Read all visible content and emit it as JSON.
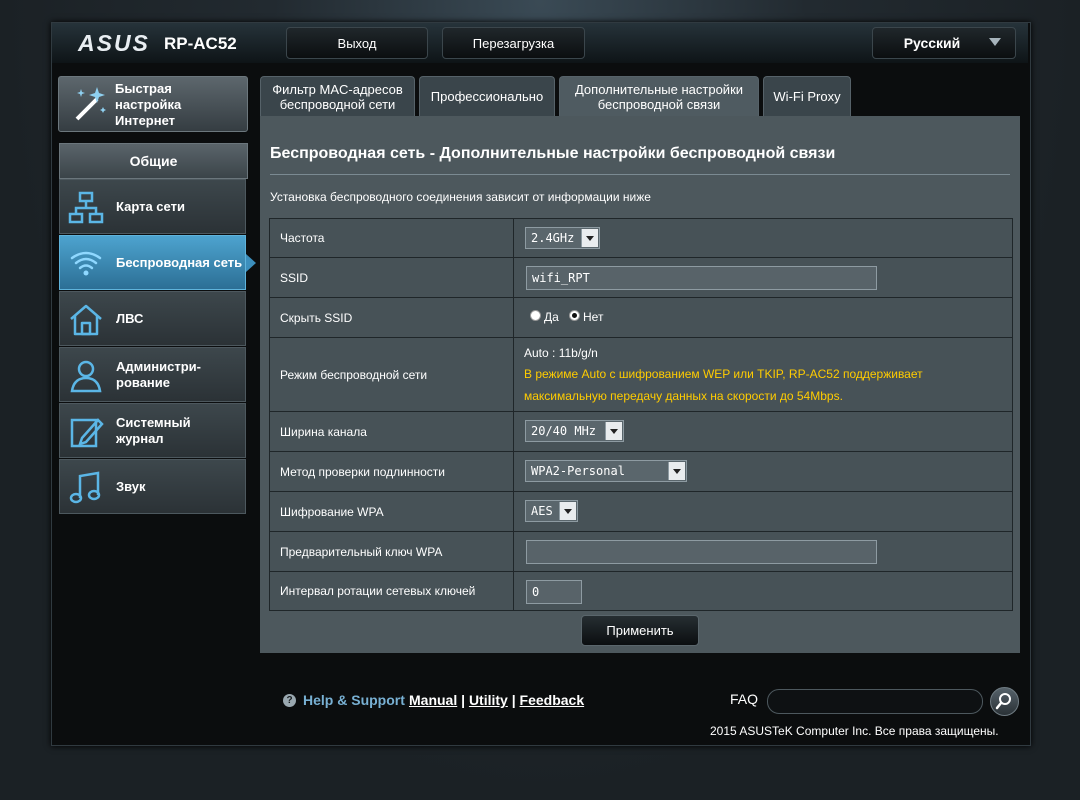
{
  "header": {
    "brand": "ASUS",
    "model": "RP-AC52",
    "logout": "Выход",
    "reboot": "Перезагрузка",
    "language": "Русский"
  },
  "sidebar": {
    "quick_setup": [
      "Быстрая",
      "настройка",
      "Интернет"
    ],
    "section": "Общие",
    "items": [
      {
        "icon": "network-map-icon",
        "lines": [
          "Карта сети"
        ]
      },
      {
        "icon": "wifi-icon",
        "lines": [
          "Беспроводная сеть"
        ]
      },
      {
        "icon": "home-icon",
        "lines": [
          "ЛВС"
        ]
      },
      {
        "icon": "user-admin-icon",
        "lines": [
          "Администри-",
          "рование"
        ]
      },
      {
        "icon": "edit-log-icon",
        "lines": [
          "Системный",
          "журнал"
        ]
      },
      {
        "icon": "music-note-icon",
        "lines": [
          "Звук"
        ]
      }
    ]
  },
  "tabs": [
    {
      "lines": [
        "Фильтр MAC-адресов",
        "беспроводной сети"
      ]
    },
    {
      "lines": [
        "Профессионально"
      ]
    },
    {
      "lines": [
        "Дополнительные настройки",
        "беспроводной связи"
      ]
    },
    {
      "lines": [
        "Wi-Fi Proxy"
      ]
    }
  ],
  "page": {
    "title": "Беспроводная сеть - Дополнительные настройки беспроводной связи",
    "description": "Установка беспроводного соединения зависит от информации ниже"
  },
  "form": {
    "frequency": {
      "label": "Частота",
      "value": "2.4GHz"
    },
    "ssid": {
      "label": "SSID",
      "value": "wifi_RPT"
    },
    "hide_ssid": {
      "label": "Скрыть SSID",
      "yes": "Да",
      "no": "Нет",
      "selected": "no"
    },
    "wireless_mode": {
      "label": "Режим беспроводной сети",
      "value": "Auto : 11b/g/n",
      "warning1": "В режиме Auto с шифрованием WEP или TKIP, RP-AC52 поддерживает",
      "warning2": "максимальную передачу данных на скорости до 54Mbps."
    },
    "channel_width": {
      "label": "Ширина канала",
      "value": "20/40 MHz"
    },
    "auth_method": {
      "label": "Метод проверки подлинности",
      "value": "WPA2-Personal"
    },
    "wpa_encryption": {
      "label": "Шифрование WPA",
      "value": "AES"
    },
    "wpa_key": {
      "label": "Предварительный ключ WPA",
      "value": ""
    },
    "key_rotation": {
      "label": "Интервал ротации сетевых ключей",
      "value": "0"
    }
  },
  "apply": "Применить",
  "footer": {
    "help": "Help & Support",
    "manual": "Manual",
    "utility": "Utility",
    "feedback": "Feedback",
    "sep": "|",
    "faq": "FAQ",
    "copyright": "2015 ASUSTeK Computer Inc. Все права защищены."
  },
  "colors": {
    "accent": "#3c8fbd",
    "warning": "#ffcc00",
    "link": "#78b0d3"
  }
}
